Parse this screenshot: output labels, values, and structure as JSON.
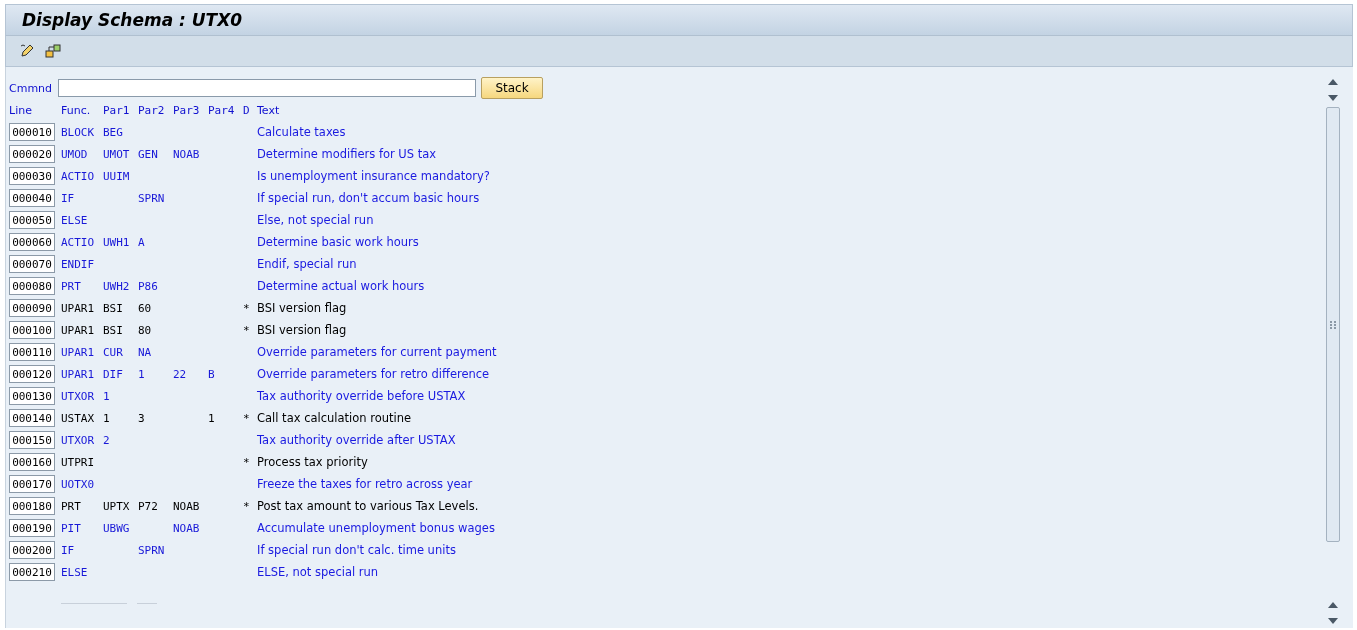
{
  "window": {
    "title": "Display Schema : UTX0"
  },
  "command": {
    "label": "Cmmnd",
    "button": "Stack"
  },
  "columns": [
    "Line",
    "Func.",
    "Par1",
    "Par2",
    "Par3",
    "Par4",
    "D",
    "Text"
  ],
  "rows": [
    {
      "line": "000010",
      "func": "BLOCK",
      "par1": "BEG",
      "par2": "",
      "par3": "",
      "par4": "",
      "d": "",
      "text": "Calculate taxes",
      "deactivated": false
    },
    {
      "line": "000020",
      "func": "UMOD",
      "par1": "UMOT",
      "par2": "GEN",
      "par3": "NOAB",
      "par4": "",
      "d": "",
      "text": "Determine modifiers for US tax",
      "deactivated": false
    },
    {
      "line": "000030",
      "func": "ACTIO",
      "par1": "UUIM",
      "par2": "",
      "par3": "",
      "par4": "",
      "d": "",
      "text": "Is unemployment insurance mandatory?",
      "deactivated": false
    },
    {
      "line": "000040",
      "func": "IF",
      "par1": "",
      "par2": "SPRN",
      "par3": "",
      "par4": "",
      "d": "",
      "text": "If special run, don't accum basic hours",
      "deactivated": false
    },
    {
      "line": "000050",
      "func": "ELSE",
      "par1": "",
      "par2": "",
      "par3": "",
      "par4": "",
      "d": "",
      "text": "Else, not special run",
      "deactivated": false
    },
    {
      "line": "000060",
      "func": "ACTIO",
      "par1": "UWH1",
      "par2": "A",
      "par3": "",
      "par4": "",
      "d": "",
      "text": "Determine basic work hours",
      "deactivated": false
    },
    {
      "line": "000070",
      "func": "ENDIF",
      "par1": "",
      "par2": "",
      "par3": "",
      "par4": "",
      "d": "",
      "text": "Endif, special run",
      "deactivated": false
    },
    {
      "line": "000080",
      "func": "PRT",
      "par1": "UWH2",
      "par2": "P86",
      "par3": "",
      "par4": "",
      "d": "",
      "text": "Determine actual work hours",
      "deactivated": false
    },
    {
      "line": "000090",
      "func": "UPAR1",
      "par1": "BSI",
      "par2": "60",
      "par3": "",
      "par4": "",
      "d": "*",
      "text": "BSI version flag",
      "deactivated": true
    },
    {
      "line": "000100",
      "func": "UPAR1",
      "par1": "BSI",
      "par2": "80",
      "par3": "",
      "par4": "",
      "d": "*",
      "text": "BSI version flag",
      "deactivated": true
    },
    {
      "line": "000110",
      "func": "UPAR1",
      "par1": "CUR",
      "par2": "NA",
      "par3": "",
      "par4": "",
      "d": "",
      "text": "Override parameters for current payment",
      "deactivated": false
    },
    {
      "line": "000120",
      "func": "UPAR1",
      "par1": "DIF",
      "par2": "1",
      "par3": "22",
      "par4": "B",
      "d": "",
      "text": "Override parameters for retro difference",
      "deactivated": false
    },
    {
      "line": "000130",
      "func": "UTXOR",
      "par1": "1",
      "par2": "",
      "par3": "",
      "par4": "",
      "d": "",
      "text": "Tax authority override before USTAX",
      "deactivated": false
    },
    {
      "line": "000140",
      "func": "USTAX",
      "par1": "1",
      "par2": "3",
      "par3": "",
      "par4": "1",
      "d": "*",
      "text": "Call tax calculation routine",
      "deactivated": true
    },
    {
      "line": "000150",
      "func": "UTXOR",
      "par1": "2",
      "par2": "",
      "par3": "",
      "par4": "",
      "d": "",
      "text": "Tax authority override after USTAX",
      "deactivated": false
    },
    {
      "line": "000160",
      "func": "UTPRI",
      "par1": "",
      "par2": "",
      "par3": "",
      "par4": "",
      "d": "*",
      "text": "Process tax priority",
      "deactivated": true
    },
    {
      "line": "000170",
      "func": "UOTX0",
      "par1": "",
      "par2": "",
      "par3": "",
      "par4": "",
      "d": "",
      "text": "Freeze the taxes for retro across year",
      "deactivated": false
    },
    {
      "line": "000180",
      "func": "PRT",
      "par1": "UPTX",
      "par2": "P72",
      "par3": "NOAB",
      "par4": "",
      "d": "*",
      "text": "Post tax amount to various Tax Levels.",
      "deactivated": true
    },
    {
      "line": "000190",
      "func": "PIT",
      "par1": "UBWG",
      "par2": "",
      "par3": "NOAB",
      "par4": "",
      "d": "",
      "text": "Accumulate unemployment bonus wages",
      "deactivated": false
    },
    {
      "line": "000200",
      "func": "IF",
      "par1": "",
      "par2": "SPRN",
      "par3": "",
      "par4": "",
      "d": "",
      "text": "If special run don't calc. time units",
      "deactivated": false
    },
    {
      "line": "000210",
      "func": "ELSE",
      "par1": "",
      "par2": "",
      "par3": "",
      "par4": "",
      "d": "",
      "text": "ELSE, not special run",
      "deactivated": false
    }
  ]
}
